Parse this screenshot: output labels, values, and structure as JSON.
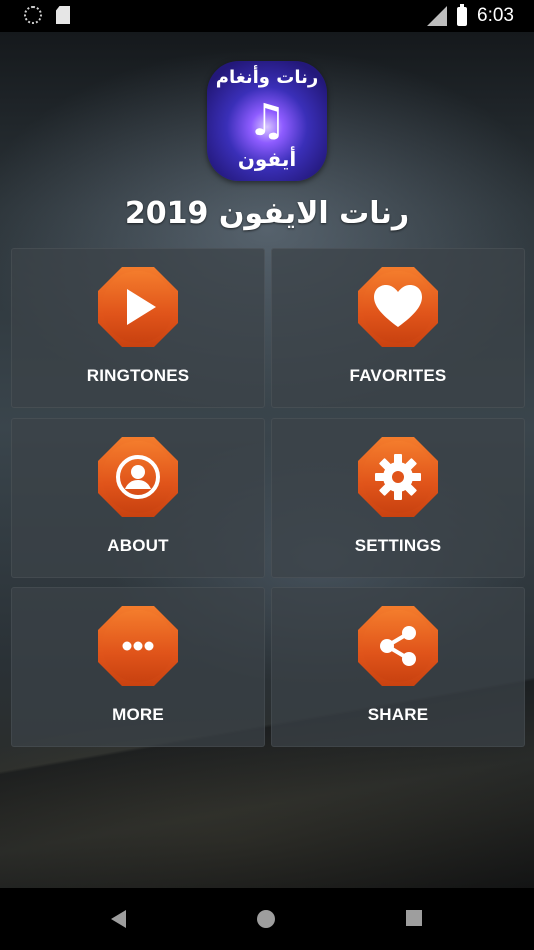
{
  "status_bar": {
    "time": "6:03",
    "left_icons": [
      "loading-spinner-icon",
      "sd-card-icon"
    ],
    "right_icons": [
      "signal-icon",
      "battery-icon"
    ]
  },
  "header": {
    "logo_top_text": "رنات وأنغام",
    "logo_bottom_text": "أيفون",
    "logo_icon": "music-note-icon",
    "title": "رنات الايفون 2019"
  },
  "menu": {
    "ringtones": {
      "label": "RINGTONES",
      "icon": "play-icon"
    },
    "favorites": {
      "label": "FAVORITES",
      "icon": "heart-icon"
    },
    "about": {
      "label": "ABOUT",
      "icon": "user-icon"
    },
    "settings": {
      "label": "SETTINGS",
      "icon": "gear-icon"
    },
    "more": {
      "label": "MORE",
      "icon": "dots-icon"
    },
    "share": {
      "label": "SHARE",
      "icon": "share-icon"
    }
  },
  "colors": {
    "accent": "#e8601f",
    "tile_bg": "#3c4248",
    "text": "#ffffff"
  },
  "nav_bar": {
    "icons": [
      "back-icon",
      "home-icon",
      "recents-icon"
    ]
  }
}
